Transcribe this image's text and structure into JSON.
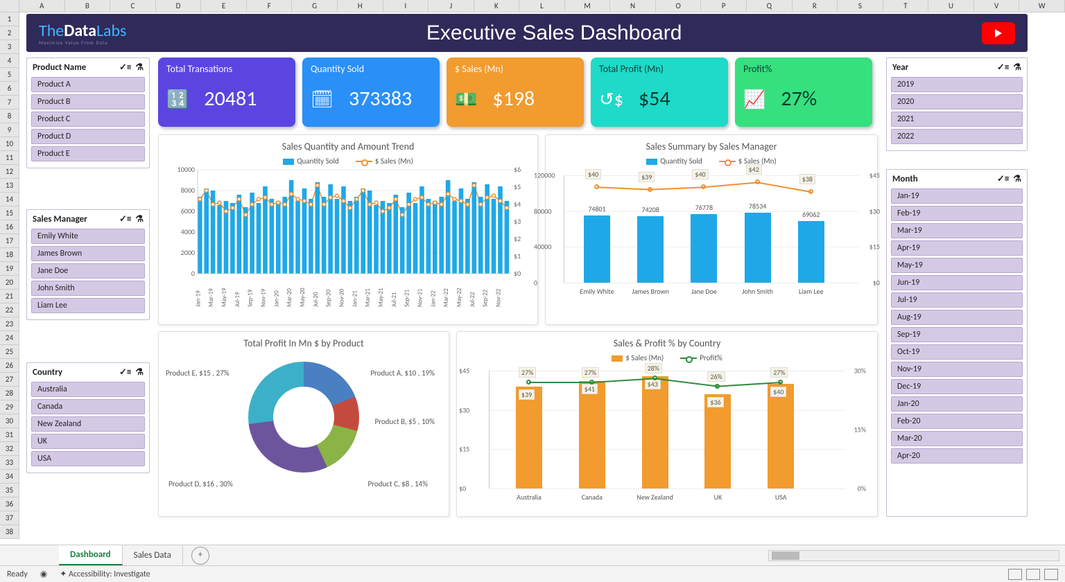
{
  "columns": [
    "A",
    "B",
    "C",
    "D",
    "E",
    "F",
    "G",
    "H",
    "I",
    "J",
    "K",
    "L",
    "M",
    "N",
    "O",
    "P",
    "Q",
    "R",
    "S",
    "T",
    "U",
    "V",
    "W"
  ],
  "rows": [
    "1",
    "2",
    "3",
    "4",
    "5",
    "6",
    "7",
    "8",
    "9",
    "10",
    "11",
    "12",
    "13",
    "14",
    "15",
    "16",
    "17",
    "18",
    "19",
    "20",
    "21",
    "22",
    "23",
    "24",
    "25",
    "26",
    "27",
    "28",
    "29",
    "30",
    "31",
    "32",
    "33",
    "34",
    "35",
    "36",
    "37",
    "38"
  ],
  "banner": {
    "logo_pre": "The",
    "logo_mid": "Data",
    "logo_post": "Labs",
    "tagline": "Maximize Value From Data",
    "title": "Executive Sales Dashboard"
  },
  "slicers": {
    "product": {
      "title": "Product Name",
      "items": [
        "Product A",
        "Product B",
        "Product C",
        "Product D",
        "Product E"
      ]
    },
    "manager": {
      "title": "Sales Manager",
      "items": [
        "Emily White",
        "James Brown",
        "Jane Doe",
        "John Smith",
        "Liam Lee"
      ]
    },
    "country": {
      "title": "Country",
      "items": [
        "Australia",
        "Canada",
        "New Zealand",
        "UK",
        "USA"
      ]
    },
    "year": {
      "title": "Year",
      "items": [
        "2019",
        "2020",
        "2021",
        "2022"
      ]
    },
    "month": {
      "title": "Month",
      "items": [
        "Jan-19",
        "Feb-19",
        "Mar-19",
        "Apr-19",
        "May-19",
        "Jun-19",
        "Jul-19",
        "Aug-19",
        "Sep-19",
        "Oct-19",
        "Nov-19",
        "Dec-19",
        "Jan-20",
        "Feb-20",
        "Mar-20",
        "Apr-20"
      ]
    }
  },
  "kpi": {
    "k1": {
      "label": "Total Transations",
      "value": "20481",
      "icon": "🔢"
    },
    "k2": {
      "label": "Quantity Sold",
      "value": "373383",
      "icon": "🗓"
    },
    "k3": {
      "label": "$ Sales (Mn)",
      "value": "$198",
      "icon": "💵"
    },
    "k4": {
      "label": "Total Profit (Mn)",
      "value": "$54",
      "icon": "↺$"
    },
    "k5": {
      "label": "Profit%",
      "value": "27%",
      "icon": "📈"
    }
  },
  "chart_data": [
    {
      "id": "trend",
      "type": "bar+line",
      "title": "Sales Quantity and Amount Trend",
      "legend": [
        "Quantity Sold",
        "$ Sales (Mn)"
      ],
      "x": [
        "Jan-19",
        "Mar-19",
        "May-19",
        "Jul-19",
        "Sep-19",
        "Nov-19",
        "Jan-20",
        "Mar-20",
        "May-20",
        "Jul-20",
        "Sep-20",
        "Nov-20",
        "Jan-21",
        "Mar-21",
        "May-21",
        "Jul-21",
        "Sep-21",
        "Nov-21",
        "Jan-22",
        "Mar-22",
        "May-22",
        "Jul-22",
        "Sep-22",
        "Nov-22"
      ],
      "series": [
        {
          "name": "Quantity Sold",
          "values": [
            7200,
            8600,
            7800,
            7000,
            6800,
            7200,
            7400,
            6800,
            7600,
            7200,
            8200,
            7600,
            6800,
            7800,
            8800,
            7400,
            8000,
            7600,
            8600,
            7800,
            8400,
            7600,
            8200,
            7400
          ]
        },
        {
          "name": "$ Sales (Mn)",
          "values": [
            4.0,
            5.0,
            4.2,
            3.8,
            3.8,
            4.0,
            4.0,
            3.6,
            4.2,
            4.0,
            4.6,
            4.2,
            3.8,
            4.2,
            4.8,
            4.0,
            4.4,
            4.2,
            4.8,
            4.2,
            4.6,
            4.2,
            4.4,
            4.0
          ]
        }
      ],
      "ylim_left": [
        0,
        10000
      ],
      "ylim_right": [
        0,
        6
      ]
    },
    {
      "id": "mgr",
      "type": "bar+line",
      "title": "Sales Summary by Sales Manager",
      "legend": [
        "Quantity Sold",
        "$ Sales (Mn)"
      ],
      "categories": [
        "Emily White",
        "James Brown",
        "Jane Doe",
        "John Smith",
        "Liam Lee"
      ],
      "series": [
        {
          "name": "Quantity Sold",
          "values": [
            74801,
            74208,
            76778,
            78534,
            69062
          ]
        },
        {
          "name": "$ Sales (Mn)",
          "values": [
            40,
            39,
            40,
            42,
            38
          ]
        }
      ],
      "ylim_left": [
        0,
        120000
      ],
      "ylim_right": [
        0,
        45
      ]
    },
    {
      "id": "donut",
      "type": "pie",
      "title": "Total Profit In Mn $ by Product",
      "slices": [
        {
          "label": "Product A, $10 , 19%",
          "value": 10,
          "pct": 19
        },
        {
          "label": "Product B, $5 , 10%",
          "value": 5,
          "pct": 10
        },
        {
          "label": "Product C, $8 , 14%",
          "value": 8,
          "pct": 14
        },
        {
          "label": "Product D, $16 , 30%",
          "value": 16,
          "pct": 30
        },
        {
          "label": "Product E, $15 , 27%",
          "value": 15,
          "pct": 27
        }
      ]
    },
    {
      "id": "country",
      "type": "bar+line",
      "title": "Sales & Profit % by Country",
      "legend": [
        "$ Sales (Mn)",
        "Profit%"
      ],
      "categories": [
        "Australia",
        "Canada",
        "New Zealand",
        "UK",
        "USA"
      ],
      "series": [
        {
          "name": "$ Sales (Mn)",
          "values": [
            39,
            41,
            43,
            36,
            40
          ]
        },
        {
          "name": "Profit%",
          "values": [
            27,
            27,
            28,
            26,
            27
          ]
        }
      ],
      "ylim_left": [
        0,
        45
      ],
      "ylim_right": [
        0,
        30
      ]
    }
  ],
  "tabs": {
    "active": "Dashboard",
    "other": "Sales Data"
  },
  "status": {
    "ready": "Ready",
    "acc": "Accessibility: Investigate"
  }
}
